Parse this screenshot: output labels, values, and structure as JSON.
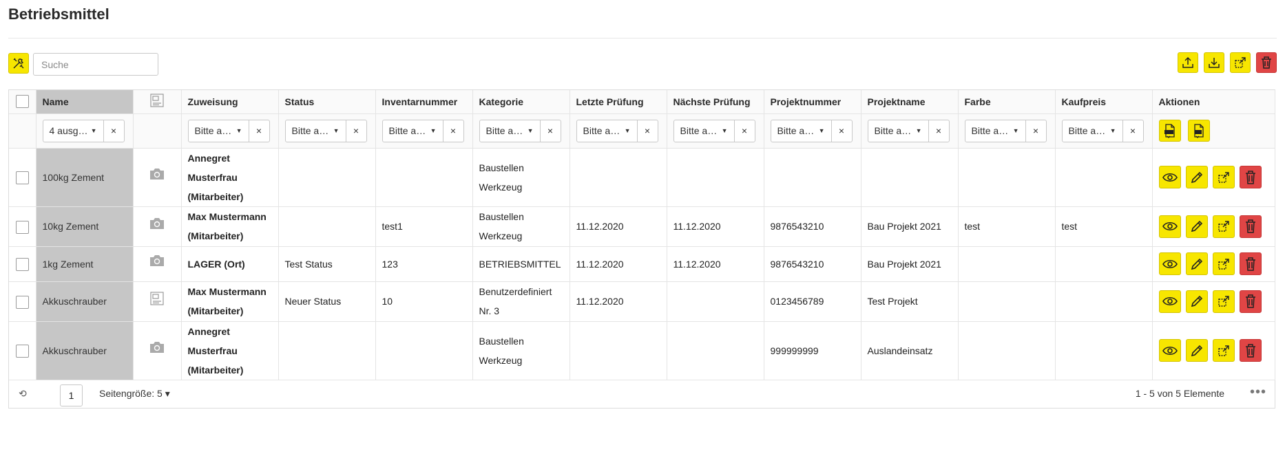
{
  "page": {
    "title": "Betriebsmittel"
  },
  "toolbar": {
    "search_placeholder": "Suche"
  },
  "columns": {
    "name": "Name",
    "assignment": "Zuweisung",
    "status": "Status",
    "inventory": "Inventarnummer",
    "category": "Kategorie",
    "last_check": "Letzte Prüfung",
    "next_check": "Nächste Prüfung",
    "project_number": "Projektnummer",
    "project_name": "Projektname",
    "color": "Farbe",
    "price": "Kaufpreis",
    "actions": "Aktionen"
  },
  "filters": {
    "name": "4 ausg…",
    "assignment": "Bitte a…",
    "status": "Bitte a…",
    "inventory": "Bitte a…",
    "category": "Bitte a…",
    "last_check": "Bitte a…",
    "next_check": "Bitte a…",
    "project_number": "Bitte a…",
    "project_name": "Bitte a…",
    "color": "Bitte a…",
    "price": "Bitte a…",
    "clear": "×",
    "caret": "▼"
  },
  "rows": [
    {
      "name": "100kg Zement",
      "thumb": "camera-icon",
      "assign1": "Annegret",
      "assign2": "Musterfrau",
      "assign3": "(Mitarbeiter)",
      "status": "",
      "inventory": "",
      "cat1": "Baustellen",
      "cat2": "Werkzeug",
      "last_check": "",
      "next_check": "",
      "project_number": "",
      "project_name": "",
      "color": "",
      "price": ""
    },
    {
      "name": "10kg Zement",
      "thumb": "camera-icon",
      "assign1": "Max Mustermann",
      "assign2": "(Mitarbeiter)",
      "assign3": "",
      "status": "",
      "inventory": "test1",
      "cat1": "Baustellen",
      "cat2": "Werkzeug",
      "last_check": "11.12.2020",
      "next_check": "11.12.2020",
      "project_number": "9876543210",
      "project_name": "Bau Projekt 2021",
      "color": "test",
      "price": "test"
    },
    {
      "name": "1kg Zement",
      "thumb": "camera-icon",
      "assign1": "LAGER (Ort)",
      "assign2": "",
      "assign3": "",
      "status": "Test Status",
      "inventory": "123",
      "cat1": "BETRIEBSMITTEL",
      "cat2": "",
      "last_check": "11.12.2020",
      "next_check": "11.12.2020",
      "project_number": "9876543210",
      "project_name": "Bau Projekt 2021",
      "color": "",
      "price": ""
    },
    {
      "name": "Akkuschrauber",
      "thumb": "image-placeholder-icon",
      "assign1": "Max Mustermann",
      "assign2": "(Mitarbeiter)",
      "assign3": "",
      "status": "Neuer Status",
      "inventory": "10",
      "cat1": "Benutzerdefiniert",
      "cat2": "Nr. 3",
      "last_check": "11.12.2020",
      "next_check": "",
      "project_number": "0123456789",
      "project_name": "Test Projekt",
      "color": "",
      "price": ""
    },
    {
      "name": "Akkuschrauber",
      "thumb": "camera-icon",
      "assign1": "Annegret",
      "assign2": "Musterfrau",
      "assign3": "(Mitarbeiter)",
      "status": "",
      "inventory": "",
      "cat1": "Baustellen",
      "cat2": "Werkzeug",
      "last_check": "",
      "next_check": "",
      "project_number": "999999999",
      "project_name": "Auslandeinsatz",
      "color": "",
      "price": ""
    }
  ],
  "pager": {
    "refresh": "⟲",
    "page": "1",
    "size_label": "Seitengröße: 5 ▾",
    "range": "1 - 5 von 5 Elemente",
    "more": "•••"
  },
  "colors": {
    "accent": "#f7e600",
    "danger": "#e04545",
    "name_column": "#c6c6c6"
  }
}
